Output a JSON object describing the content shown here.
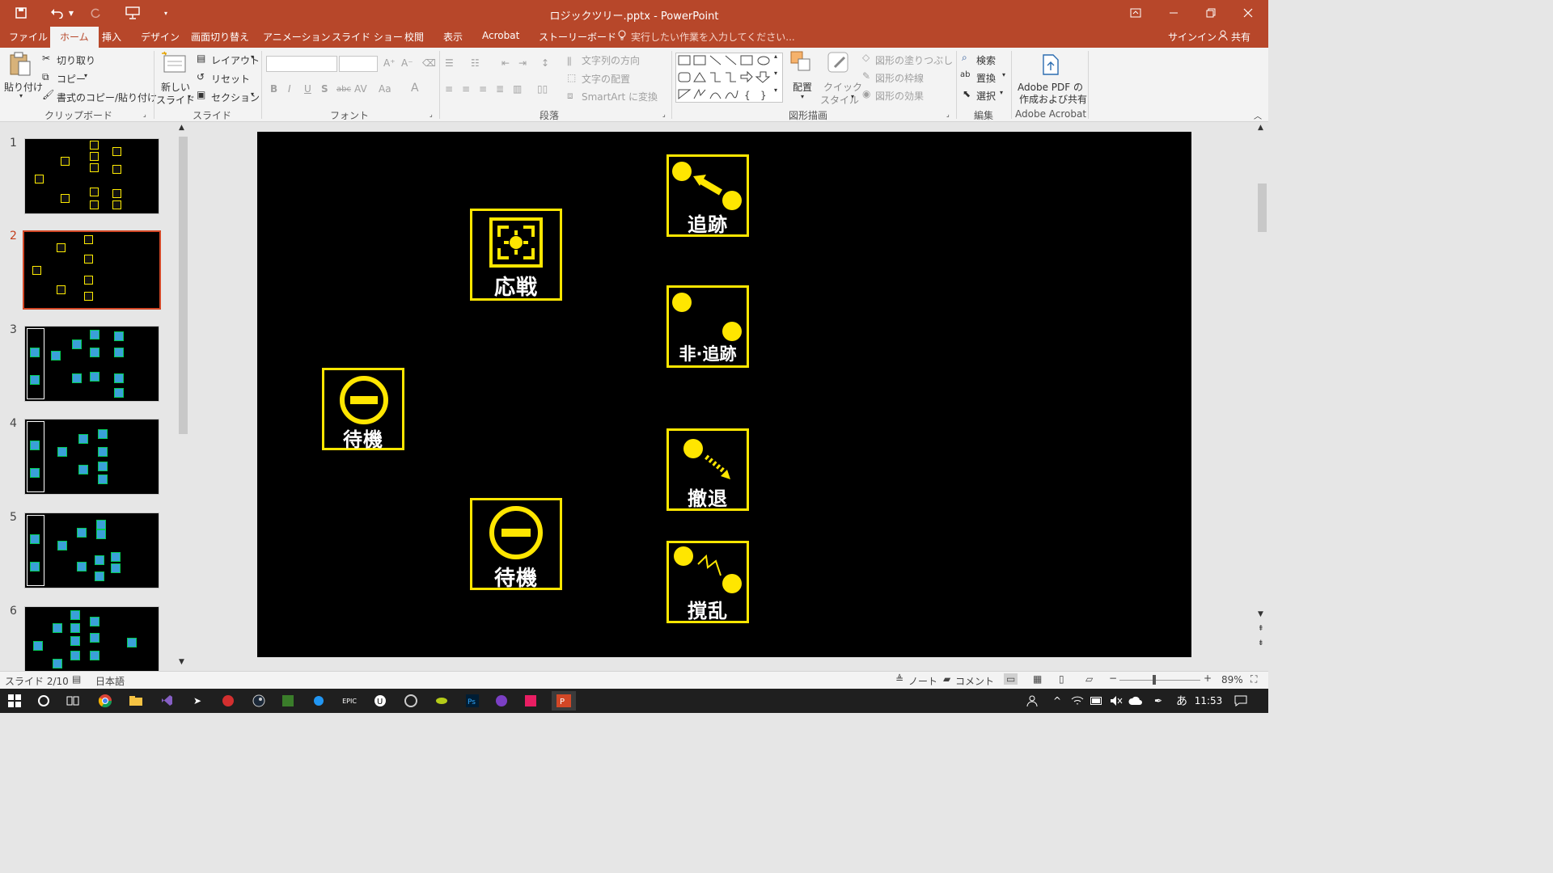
{
  "window": {
    "title": "ロジックツリー.pptx - PowerPoint"
  },
  "tabs": [
    {
      "label": "ファイル"
    },
    {
      "label": "ホーム"
    },
    {
      "label": "挿入"
    },
    {
      "label": "デザイン"
    },
    {
      "label": "画面切り替え"
    },
    {
      "label": "アニメーション"
    },
    {
      "label": "スライド ショー"
    },
    {
      "label": "校閲"
    },
    {
      "label": "表示"
    },
    {
      "label": "Acrobat"
    },
    {
      "label": "ストーリーボード"
    }
  ],
  "tell_me": {
    "placeholder": "実行したい作業を入力してください..."
  },
  "account": {
    "signin": "サインイン",
    "share": "共有"
  },
  "ribbon": {
    "clipboard": {
      "paste": "貼り付け",
      "cut": "切り取り",
      "copy": "コピー",
      "format_painter": "書式のコピー/貼り付け",
      "label": "クリップボード"
    },
    "slides": {
      "new_slide_1": "新しい",
      "new_slide_2": "スライド",
      "layout": "レイアウト",
      "reset": "リセット",
      "section": "セクション",
      "label": "スライド"
    },
    "font": {
      "label": "フォント"
    },
    "paragraph": {
      "text_direction": "文字列の方向",
      "align_text": "文字の配置",
      "smartart": "SmartArt に変換",
      "label": "段落"
    },
    "drawing": {
      "arrange": "配置",
      "quick_styles_1": "クイック",
      "quick_styles_2": "スタイル",
      "shape_fill": "図形の塗りつぶし",
      "shape_outline": "図形の枠線",
      "shape_effects": "図形の効果",
      "label": "図形描画"
    },
    "editing": {
      "find": "検索",
      "replace": "置換",
      "select": "選択",
      "label": "編集"
    },
    "acrobat": {
      "create_1": "Adobe PDF の",
      "create_2": "作成および共有",
      "label": "Adobe Acrobat"
    }
  },
  "thumbnails": [
    {
      "num": "1"
    },
    {
      "num": "2"
    },
    {
      "num": "3"
    },
    {
      "num": "4"
    },
    {
      "num": "5"
    },
    {
      "num": "6"
    }
  ],
  "slide": {
    "icons": [
      {
        "label": "応戦",
        "glyph": "crosshair-icon"
      },
      {
        "label": "待機",
        "glyph": "minus-circle-icon"
      },
      {
        "label": "待機",
        "glyph": "minus-circle-icon"
      },
      {
        "label": "追跡",
        "glyph": "chase-icon"
      },
      {
        "label": "非·追跡",
        "glyph": "no-chase-icon"
      },
      {
        "label": "撤退",
        "glyph": "retreat-icon"
      },
      {
        "label": "撹乱",
        "glyph": "disrupt-icon"
      }
    ],
    "colors": {
      "border": "#ffe600",
      "dot": "#ffe600",
      "background": "#000000",
      "text": "#ffffff"
    }
  },
  "status": {
    "slide": "スライド 2/10",
    "language": "日本語",
    "notes": "ノート",
    "comments": "コメント",
    "zoom": "89%"
  },
  "taskbar": {
    "time": "11:53",
    "ime": "あ"
  }
}
